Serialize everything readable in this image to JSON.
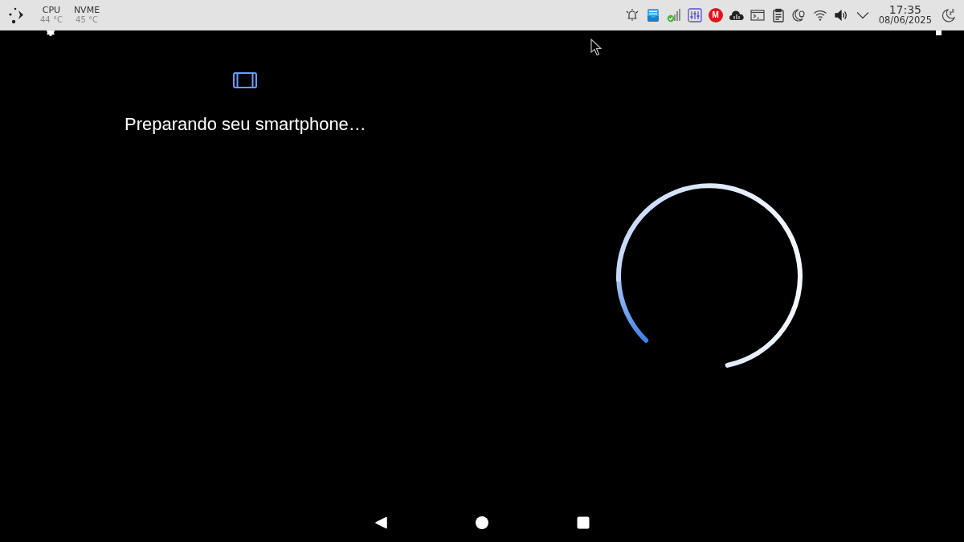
{
  "taskbar": {
    "sensors": [
      {
        "label": "CPU",
        "reading": "44 °C"
      },
      {
        "label": "NVME",
        "reading": "45 °C"
      }
    ],
    "tray_badge": {
      "letter": "M"
    },
    "clock": {
      "time": "17:35",
      "date": "08/06/2025"
    }
  },
  "screen": {
    "message": "Preparando seu smartphone…"
  }
}
